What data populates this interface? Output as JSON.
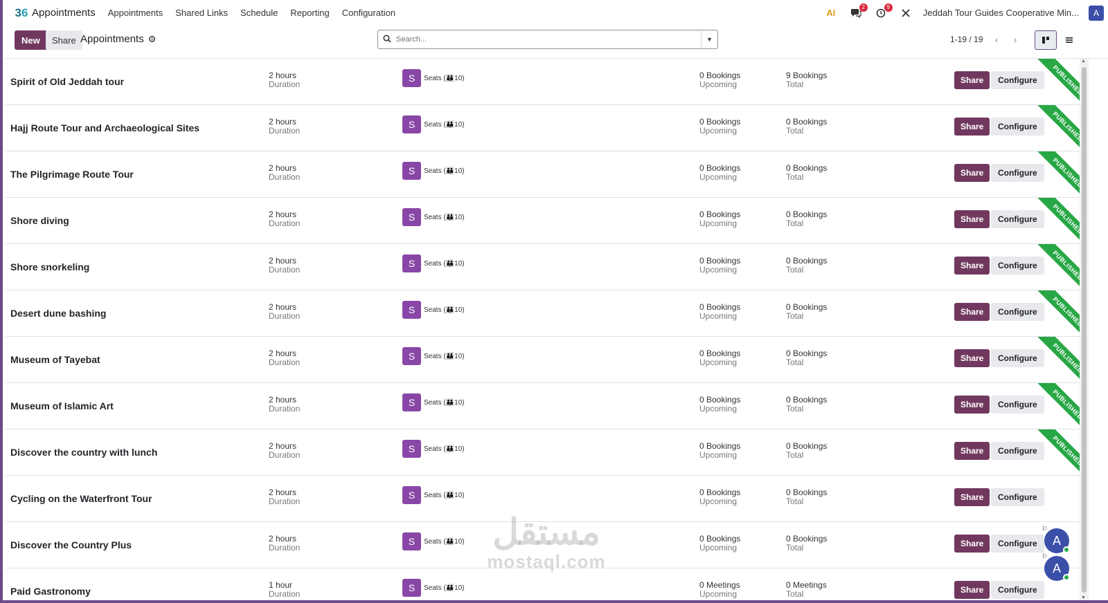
{
  "app": {
    "logo_left": "3",
    "logo_right": "6",
    "name": "Appointments"
  },
  "nav": {
    "items": [
      "Appointments",
      "Shared Links",
      "Schedule",
      "Reporting",
      "Configuration"
    ]
  },
  "systray": {
    "ai_label": "AI",
    "messages_badge": "2",
    "activities_badge": "9",
    "company": "Jeddah Tour Guides Cooperative Min...",
    "user_initial": "A"
  },
  "control": {
    "new_label": "New",
    "share_label": "Share",
    "breadcrumb": "Appointments",
    "search_placeholder": "Search...",
    "pager": "1-19 / 19"
  },
  "records": [
    {
      "name": "Spirit of Old Jeddah tour",
      "duration_value": "2 hours",
      "duration_label": "Duration",
      "resource_initial": "S",
      "resource_label": "Seats (👪10)",
      "upcoming_value": "0 Bookings",
      "upcoming_label": "Upcoming",
      "total_value": "9 Bookings",
      "total_label": "Total",
      "share": "Share",
      "configure": "Configure",
      "ribbon": "PUBLISHED",
      "published": true
    },
    {
      "name": "Hajj Route Tour and Archaeological Sites",
      "duration_value": "2 hours",
      "duration_label": "Duration",
      "resource_initial": "S",
      "resource_label": "Seats (👪10)",
      "upcoming_value": "0 Bookings",
      "upcoming_label": "Upcoming",
      "total_value": "0 Bookings",
      "total_label": "Total",
      "share": "Share",
      "configure": "Configure",
      "ribbon": "PUBLISHED",
      "published": true
    },
    {
      "name": "The Pilgrimage Route Tour",
      "duration_value": "2 hours",
      "duration_label": "Duration",
      "resource_initial": "S",
      "resource_label": "Seats (👪10)",
      "upcoming_value": "0 Bookings",
      "upcoming_label": "Upcoming",
      "total_value": "0 Bookings",
      "total_label": "Total",
      "share": "Share",
      "configure": "Configure",
      "ribbon": "PUBLISHED",
      "published": true
    },
    {
      "name": "Shore diving",
      "duration_value": "2 hours",
      "duration_label": "Duration",
      "resource_initial": "S",
      "resource_label": "Seats (👪10)",
      "upcoming_value": "0 Bookings",
      "upcoming_label": "Upcoming",
      "total_value": "0 Bookings",
      "total_label": "Total",
      "share": "Share",
      "configure": "Configure",
      "ribbon": "PUBLISHED",
      "published": true
    },
    {
      "name": "Shore snorkeling",
      "duration_value": "2 hours",
      "duration_label": "Duration",
      "resource_initial": "S",
      "resource_label": "Seats (👪10)",
      "upcoming_value": "0 Bookings",
      "upcoming_label": "Upcoming",
      "total_value": "0 Bookings",
      "total_label": "Total",
      "share": "Share",
      "configure": "Configure",
      "ribbon": "PUBLISHED",
      "published": true
    },
    {
      "name": "Desert dune bashing",
      "duration_value": "2 hours",
      "duration_label": "Duration",
      "resource_initial": "S",
      "resource_label": "Seats (👪10)",
      "upcoming_value": "0 Bookings",
      "upcoming_label": "Upcoming",
      "total_value": "0 Bookings",
      "total_label": "Total",
      "share": "Share",
      "configure": "Configure",
      "ribbon": "PUBLISHED",
      "published": true
    },
    {
      "name": "Museum of Tayebat",
      "duration_value": "2 hours",
      "duration_label": "Duration",
      "resource_initial": "S",
      "resource_label": "Seats (👪10)",
      "upcoming_value": "0 Bookings",
      "upcoming_label": "Upcoming",
      "total_value": "0 Bookings",
      "total_label": "Total",
      "share": "Share",
      "configure": "Configure",
      "ribbon": "PUBLISHED",
      "published": true
    },
    {
      "name": "Museum of Islamic Art",
      "duration_value": "2 hours",
      "duration_label": "Duration",
      "resource_initial": "S",
      "resource_label": "Seats (👪10)",
      "upcoming_value": "0 Bookings",
      "upcoming_label": "Upcoming",
      "total_value": "0 Bookings",
      "total_label": "Total",
      "share": "Share",
      "configure": "Configure",
      "ribbon": "PUBLISHED",
      "published": true
    },
    {
      "name": "Discover the country with lunch",
      "duration_value": "2 hours",
      "duration_label": "Duration",
      "resource_initial": "S",
      "resource_label": "Seats (👪10)",
      "upcoming_value": "0 Bookings",
      "upcoming_label": "Upcoming",
      "total_value": "0 Bookings",
      "total_label": "Total",
      "share": "Share",
      "configure": "Configure",
      "ribbon": "PUBLISHED",
      "published": true
    },
    {
      "name": "Cycling on the Waterfront Tour",
      "duration_value": "2 hours",
      "duration_label": "Duration",
      "resource_initial": "S",
      "resource_label": "Seats (👪10)",
      "upcoming_value": "0 Bookings",
      "upcoming_label": "Upcoming",
      "total_value": "0 Bookings",
      "total_label": "Total",
      "share": "Share",
      "configure": "Configure",
      "ribbon": "",
      "published": false
    },
    {
      "name": "Discover the Country Plus",
      "duration_value": "2 hours",
      "duration_label": "Duration",
      "resource_initial": "S",
      "resource_label": "Seats (👪10)",
      "upcoming_value": "0 Bookings",
      "upcoming_label": "Upcoming",
      "total_value": "0 Bookings",
      "total_label": "Total",
      "share": "Share",
      "configure": "Configure",
      "ribbon": "",
      "published": false
    },
    {
      "name": "Paid Gastronomy",
      "duration_value": "1 hour",
      "duration_label": "Duration",
      "resource_initial": "S",
      "resource_label": "Seats (👪10)",
      "upcoming_value": "0 Meetings",
      "upcoming_label": "Upcoming",
      "total_value": "0 Meetings",
      "total_label": "Total",
      "share": "Share",
      "configure": "Configure",
      "ribbon": "",
      "published": false
    }
  ],
  "chat": {
    "initial": "A"
  },
  "watermark": {
    "arabic": "مستقل",
    "latin": "mostaql.com"
  },
  "colors": {
    "primary": "#71385f",
    "ribbon": "#28a745",
    "resource": "#8847a6",
    "avatar": "#3b4fa8"
  }
}
